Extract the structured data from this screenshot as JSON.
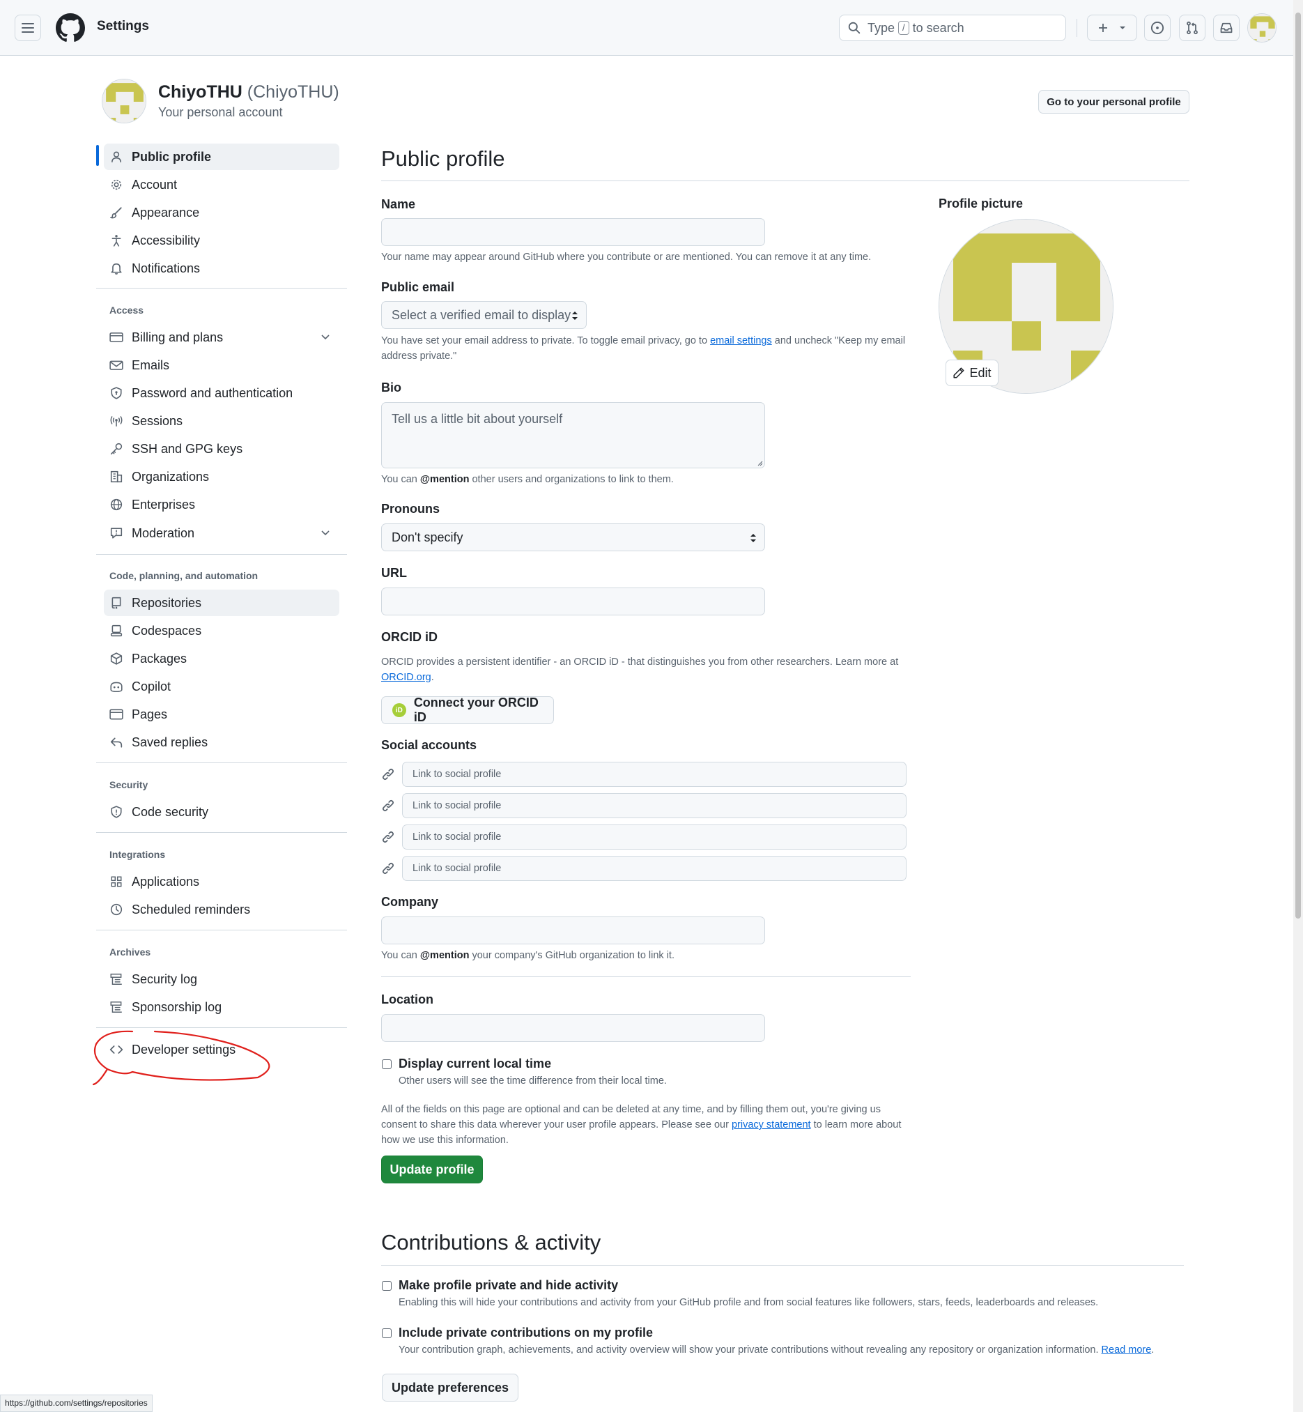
{
  "header": {
    "title": "Settings",
    "search_prefix": "Type",
    "search_key": "/",
    "search_suffix": "to search"
  },
  "account": {
    "display_name": "ChiyoTHU",
    "login": "(ChiyoTHU)",
    "subtitle": "Your personal account",
    "go_profile_label": "Go to your personal profile"
  },
  "sidebar": {
    "main": [
      {
        "label": "Public profile",
        "icon": "person-icon"
      },
      {
        "label": "Account",
        "icon": "gear-icon"
      },
      {
        "label": "Appearance",
        "icon": "paintbrush-icon"
      },
      {
        "label": "Accessibility",
        "icon": "accessibility-icon"
      },
      {
        "label": "Notifications",
        "icon": "bell-icon"
      }
    ],
    "access_heading": "Access",
    "access": [
      {
        "label": "Billing and plans",
        "icon": "credit-card-icon"
      },
      {
        "label": "Emails",
        "icon": "mail-icon"
      },
      {
        "label": "Password and authentication",
        "icon": "shield-lock-icon"
      },
      {
        "label": "Sessions",
        "icon": "broadcast-icon"
      },
      {
        "label": "SSH and GPG keys",
        "icon": "key-icon"
      },
      {
        "label": "Organizations",
        "icon": "organization-icon"
      },
      {
        "label": "Enterprises",
        "icon": "globe-icon"
      },
      {
        "label": "Moderation",
        "icon": "report-icon"
      }
    ],
    "code_heading": "Code, planning, and automation",
    "code": [
      {
        "label": "Repositories",
        "icon": "repo-icon"
      },
      {
        "label": "Codespaces",
        "icon": "codespaces-icon"
      },
      {
        "label": "Packages",
        "icon": "package-icon"
      },
      {
        "label": "Copilot",
        "icon": "copilot-icon"
      },
      {
        "label": "Pages",
        "icon": "browser-icon"
      },
      {
        "label": "Saved replies",
        "icon": "reply-icon"
      }
    ],
    "security_heading": "Security",
    "security": [
      {
        "label": "Code security",
        "icon": "shield-icon"
      }
    ],
    "integrations_heading": "Integrations",
    "integrations": [
      {
        "label": "Applications",
        "icon": "apps-icon"
      },
      {
        "label": "Scheduled reminders",
        "icon": "clock-icon"
      }
    ],
    "archives_heading": "Archives",
    "archives": [
      {
        "label": "Security log",
        "icon": "log-icon"
      },
      {
        "label": "Sponsorship log",
        "icon": "log-icon"
      }
    ],
    "developer": {
      "label": "Developer settings",
      "icon": "code-icon"
    }
  },
  "main": {
    "title": "Public profile",
    "name_label": "Name",
    "name_value": "",
    "name_note": "Your name may appear around GitHub where you contribute or are mentioned. You can remove it at any time.",
    "email_label": "Public email",
    "email_select": "Select a verified email to display",
    "email_note_before": "You have set your email address to private. To toggle email privacy, go to",
    "email_note_link": "email settings",
    "email_note_after": "and uncheck \"Keep my email address private.\"",
    "bio_label": "Bio",
    "bio_placeholder": "Tell us a little bit about yourself",
    "bio_note_before": "You can",
    "bio_note_mention": "@mention",
    "bio_note_after": "other users and organizations to link to them.",
    "pronouns_label": "Pronouns",
    "pronouns_value": "Don't specify",
    "url_label": "URL",
    "orcid_label": "ORCID iD",
    "orcid_note": "ORCID provides a persistent identifier - an ORCID iD - that distinguishes you from other researchers. Learn more at",
    "orcid_link": "ORCID.org",
    "orcid_note_end": ".",
    "orcid_badge": "iD",
    "orcid_button": "Connect your ORCID iD",
    "social_label": "Social accounts",
    "social_placeholder": "Link to social profile",
    "company_label": "Company",
    "company_note_before": "You can",
    "company_note_mention": "@mention",
    "company_note_after": "your company's GitHub organization to link it.",
    "location_label": "Location",
    "local_time_label": "Display current local time",
    "local_time_note": "Other users will see the time difference from their local time.",
    "optional_note_before": "All of the fields on this page are optional and can be deleted at any time, and by filling them out, you're giving us consent to share this data wherever your user profile appears. Please see our",
    "optional_note_link": "privacy statement",
    "optional_note_after": "to learn more about how we use this information.",
    "update_button": "Update profile",
    "profile_picture_label": "Profile picture",
    "edit_button": "Edit"
  },
  "contributions": {
    "title": "Contributions & activity",
    "private_label": "Make profile private and hide activity",
    "private_note": "Enabling this will hide your contributions and activity from your GitHub profile and from social features like followers, stars, feeds, leaderboards and releases.",
    "include_label": "Include private contributions on my profile",
    "include_note": "Your contribution graph, achievements, and activity overview will show your private contributions without revealing any repository or organization information.",
    "include_link": "Read more",
    "include_note_end": ".",
    "update_button": "Update preferences"
  },
  "status_bar_url": "https://github.com/settings/repositories",
  "colors": {
    "accent": "#0969da",
    "primary_button": "#1f883d",
    "avatar_fg": "#c9c550",
    "avatar_bg": "#f0f0f0",
    "annotation": "#e0201c"
  }
}
